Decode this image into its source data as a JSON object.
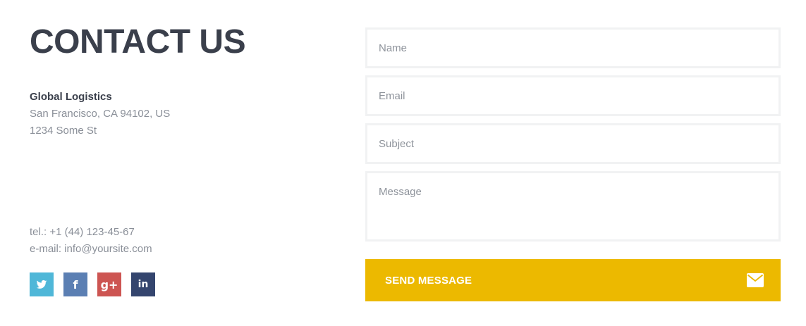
{
  "contact": {
    "title": "CONTACT US",
    "company": "Global Logistics",
    "address_line1": "San Francisco, CA 94102, US",
    "address_line2": "1234 Some St",
    "tel": "tel.: +1 (44) 123-45-67",
    "email": "e-mail: info@yoursite.com"
  },
  "socials": [
    {
      "name": "twitter",
      "glyph": "",
      "color": "#4fb7d8"
    },
    {
      "name": "facebook",
      "glyph": "f",
      "color": "#5b7fb3"
    },
    {
      "name": "google-plus",
      "glyph": "g+",
      "color": "#cd5552"
    },
    {
      "name": "linkedin",
      "glyph": "in",
      "color": "#34456e"
    }
  ],
  "form": {
    "name_placeholder": "Name",
    "email_placeholder": "Email",
    "subject_placeholder": "Subject",
    "message_placeholder": "Message",
    "send_label": "SEND MESSAGE",
    "send_icon": "envelope-icon"
  },
  "colors": {
    "heading": "#3a3f4b",
    "text_muted": "#8a8f98",
    "accent": "#ecb900",
    "field_border": "#f1f2f3"
  }
}
